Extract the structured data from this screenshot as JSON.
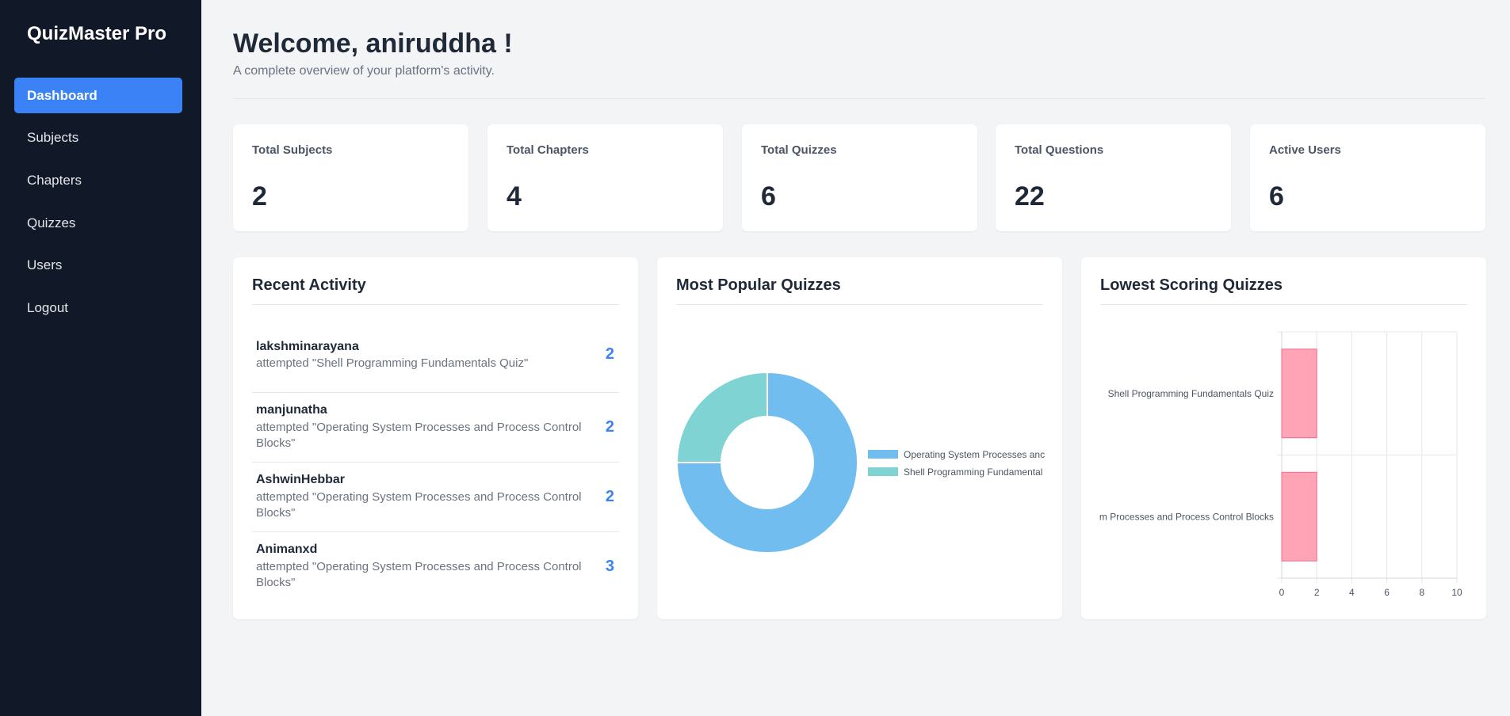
{
  "sidebar": {
    "brand": "QuizMaster Pro",
    "items": [
      {
        "label": "Dashboard"
      },
      {
        "label": "Subjects"
      },
      {
        "label": "Chapters"
      },
      {
        "label": "Quizzes"
      },
      {
        "label": "Users"
      },
      {
        "label": "Logout"
      }
    ]
  },
  "header": {
    "title": "Welcome, aniruddha !",
    "subtitle": "A complete overview of your platform's activity."
  },
  "stats": [
    {
      "label": "Total Subjects",
      "value": "2"
    },
    {
      "label": "Total Chapters",
      "value": "4"
    },
    {
      "label": "Total Quizzes",
      "value": "6"
    },
    {
      "label": "Total Questions",
      "value": "22"
    },
    {
      "label": "Active Users",
      "value": "6"
    }
  ],
  "recent_activity": {
    "title": "Recent Activity",
    "items": [
      {
        "user": "lakshminarayana",
        "action": "attempted \"Shell Programming Fundamentals Quiz\"",
        "score": "2"
      },
      {
        "user": "manjunatha",
        "action": "attempted \"Operating System Processes and Process Control Blocks\"",
        "score": "2"
      },
      {
        "user": "AshwinHebbar",
        "action": "attempted \"Operating System Processes and Process Control Blocks\"",
        "score": "2"
      },
      {
        "user": "Animanxd",
        "action": "attempted \"Operating System Processes and Process Control Blocks\"",
        "score": "3"
      }
    ]
  },
  "popular": {
    "title": "Most Popular Quizzes"
  },
  "lowest": {
    "title": "Lowest Scoring Quizzes"
  },
  "chart_data": [
    {
      "type": "pie",
      "variant": "doughnut",
      "labels": [
        "Operating System Processes and Process Control Blocks",
        "Shell Programming Fundamentals Quiz"
      ],
      "legend_display": [
        "Operating System Processes anc",
        "Shell Programming Fundamental"
      ],
      "values": [
        3,
        1
      ],
      "colors": [
        "#72bdf0",
        "#7fd3d3"
      ],
      "legend": "right"
    },
    {
      "type": "bar",
      "orientation": "horizontal",
      "categories": [
        "Shell Programming Fundamentals Quiz",
        "Operating System Processes and Process Control Blocks"
      ],
      "category_display": [
        "Shell Programming Fundamentals Quiz",
        "m Processes and Process Control Blocks"
      ],
      "values": [
        2,
        2
      ],
      "xlim": [
        0,
        10
      ],
      "xticks": [
        "0",
        "2",
        "4",
        "6",
        "8",
        "10"
      ],
      "grid": true,
      "color": "#ffa3b6",
      "border_color": "#f06b8a"
    }
  ]
}
